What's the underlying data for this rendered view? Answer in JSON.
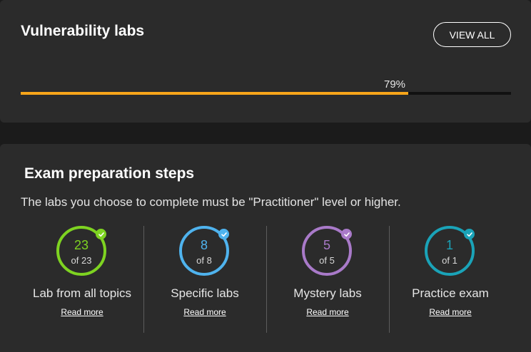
{
  "vulnerability": {
    "title": "Vulnerability labs",
    "view_all_label": "VIEW ALL",
    "progress_label": "79%",
    "progress_fraction": 0.79,
    "progress_color": "#f7a51a"
  },
  "exam": {
    "title": "Exam preparation steps",
    "subtitle": "The labs you choose to complete must be \"Practitioner\" level or higher.",
    "steps": [
      {
        "count": "23",
        "of_text": "of 23",
        "label": "Lab from all topics",
        "read_more": "Read more",
        "color": "#7ed321",
        "icon": "checkmark-icon"
      },
      {
        "count": "8",
        "of_text": "of 8",
        "label": "Specific labs",
        "read_more": "Read more",
        "color": "#4fb3ee",
        "icon": "checkmark-icon"
      },
      {
        "count": "5",
        "of_text": "of 5",
        "label": "Mystery labs",
        "read_more": "Read more",
        "color": "#a97ac9",
        "icon": "checkmark-icon"
      },
      {
        "count": "1",
        "of_text": "of 1",
        "label": "Practice exam",
        "read_more": "Read more",
        "color": "#1aa3b8",
        "icon": "checkmark-icon"
      }
    ]
  }
}
